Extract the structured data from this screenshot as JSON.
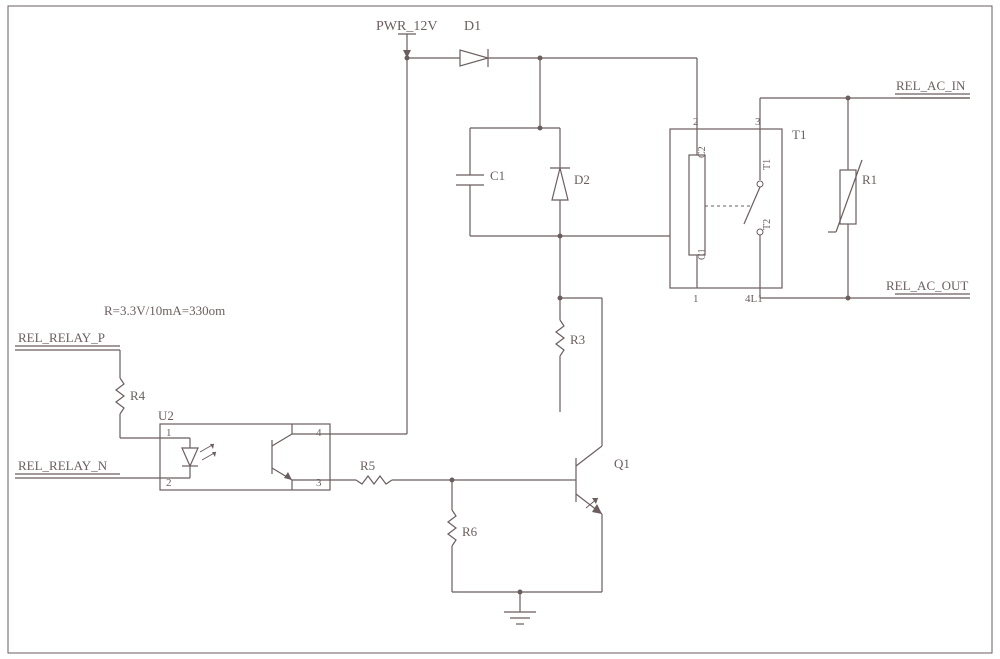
{
  "labels": {
    "pwr": "PWR_12V",
    "d1": "D1",
    "d2": "D2",
    "c1": "C1",
    "r1": "R1",
    "r3": "R3",
    "r4": "R4",
    "r5": "R5",
    "r6": "R6",
    "q1": "Q1",
    "u2": "U2",
    "t1": "T1",
    "relay_pin1": "1",
    "relay_pin2": "2",
    "relay_pin3": "3",
    "relay_pin4l1": "4L1",
    "relay_coilC1": "C1",
    "relay_coilC2": "C2",
    "relay_swT1": "T1",
    "relay_swT2": "T2",
    "opto_pin1": "1",
    "opto_pin2": "2",
    "opto_pin3": "3",
    "opto_pin4": "4",
    "net_relay_p": "REL_RELAY_P",
    "net_relay_n": "REL_RELAY_N",
    "net_ac_in": "REL_AC_IN",
    "net_ac_out": "REL_AC_OUT",
    "note": "R=3.3V/10mA=330om"
  }
}
